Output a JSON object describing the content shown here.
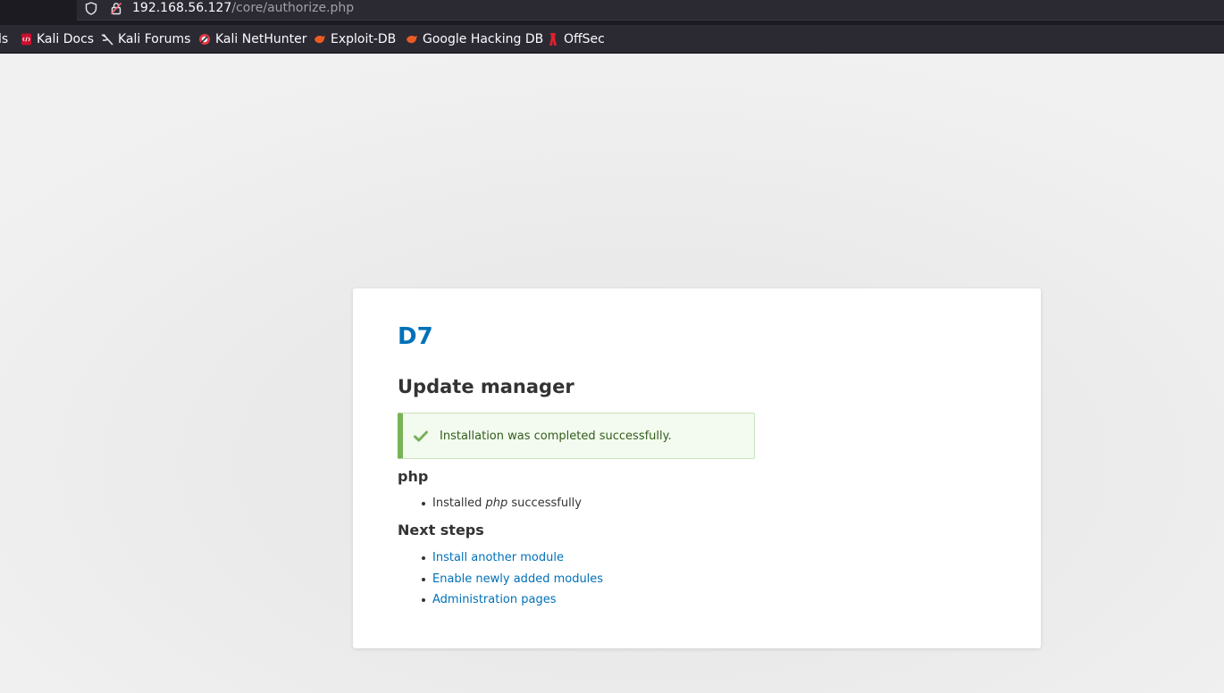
{
  "browser": {
    "url_host": "192.168.56.127",
    "url_path": "/core/authorize.php",
    "bookmarks": [
      {
        "label": "ls",
        "icon": "none"
      },
      {
        "label": "Kali Docs",
        "icon": "kali-docs-icon"
      },
      {
        "label": "Kali Forums",
        "icon": "kali-dragon-icon"
      },
      {
        "label": "Kali NetHunter",
        "icon": "nethunter-icon"
      },
      {
        "label": "Exploit-DB",
        "icon": "exploit-db-icon"
      },
      {
        "label": "Google Hacking DB",
        "icon": "ghdb-icon"
      },
      {
        "label": "OffSec",
        "icon": "offsec-icon"
      }
    ]
  },
  "page": {
    "site_name": "D7",
    "title": "Update manager",
    "status_message": "Installation was completed successfully.",
    "project_heading": "php",
    "project_results": [
      {
        "prefix": "Installed ",
        "emphasis": "php",
        "suffix": " successfully"
      }
    ],
    "next_steps_heading": "Next steps",
    "next_steps": [
      "Install another module",
      "Enable newly added modules",
      "Administration pages"
    ]
  },
  "colors": {
    "link": "#0071b8",
    "success_border": "#77b259",
    "success_bg": "#f3faef",
    "success_text": "#325e1c",
    "browser_bg": "#2b2a33"
  }
}
